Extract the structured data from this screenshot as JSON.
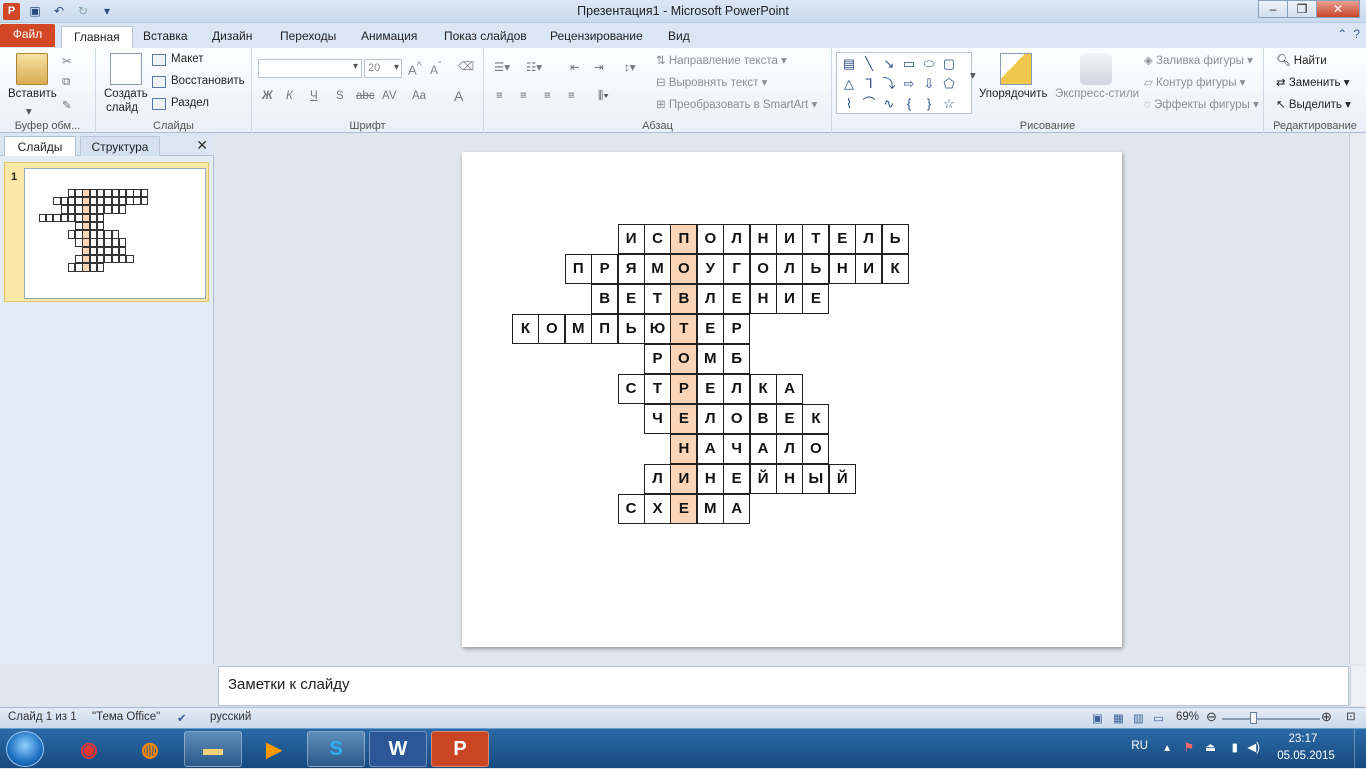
{
  "window": {
    "title": "Презентация1 - Microsoft PowerPoint",
    "app_letter": "P"
  },
  "tabs": [
    "Главная",
    "Вставка",
    "Дизайн",
    "Переходы",
    "Анимация",
    "Показ слайдов",
    "Рецензирование",
    "Вид"
  ],
  "file_tab": "Файл",
  "ribbon": {
    "clipboard": {
      "paste": "Вставить",
      "group": "Буфер обм..."
    },
    "slides": {
      "new_slide_1": "Создать",
      "new_slide_2": "слайд",
      "layout": "Макет",
      "reset": "Восстановить",
      "section": "Раздел",
      "group": "Слайды"
    },
    "font": {
      "font_size": "20",
      "bold": "Ж",
      "italic": "К",
      "underline": "Ч",
      "shadow": "S",
      "strike": "abc",
      "spacing": "AV",
      "case": "Aa",
      "color": "A",
      "group": "Шрифт"
    },
    "paragraph": {
      "text_direction": "Направление текста",
      "align_text": "Выровнять текст",
      "smartart": "Преобразовать в SmartArt",
      "group": "Абзац"
    },
    "drawing": {
      "arrange": "Упорядочить",
      "quick_styles": "Экспресс-стили",
      "fill": "Заливка фигуры",
      "outline": "Контур фигуры",
      "effects": "Эффекты фигуры",
      "group": "Рисование"
    },
    "editing": {
      "find": "Найти",
      "replace": "Заменить",
      "select": "Выделить",
      "group": "Редактирование"
    }
  },
  "left_pane": {
    "tab_slides": "Слайды",
    "tab_outline": "Структура",
    "slide_number": "1"
  },
  "crossword": {
    "rows": [
      {
        "word": "ИСПОЛНИТЕЛЬ",
        "start": 4
      },
      {
        "word": "ПРЯМОУГОЛЬНИК",
        "start": 2
      },
      {
        "word": "ВЕТВЛЕНИЕ",
        "start": 3
      },
      {
        "word": "КОМПЬЮТЕР",
        "start": 0
      },
      {
        "word": "РОМБ",
        "start": 5
      },
      {
        "word": "СТРЕЛКА",
        "start": 4
      },
      {
        "word": "ЧЕЛОВЕК",
        "start": 5
      },
      {
        "word": "НАЧАЛО",
        "start": 6
      },
      {
        "word": "ЛИНЕЙНЫЙ",
        "start": 5
      },
      {
        "word": "СХЕМА",
        "start": 4
      }
    ],
    "key_column": 6,
    "key_color": "#fbd5b5"
  },
  "notes_placeholder": "Заметки к слайду",
  "status": {
    "slide_info": "Слайд 1 из 1",
    "theme": "\"Тема Office\"",
    "language": "русский",
    "zoom": "69%",
    "zoom_level": 0.69
  },
  "taskbar": {
    "lang": "RU",
    "time": "23:17",
    "date": "05.05.2015"
  }
}
